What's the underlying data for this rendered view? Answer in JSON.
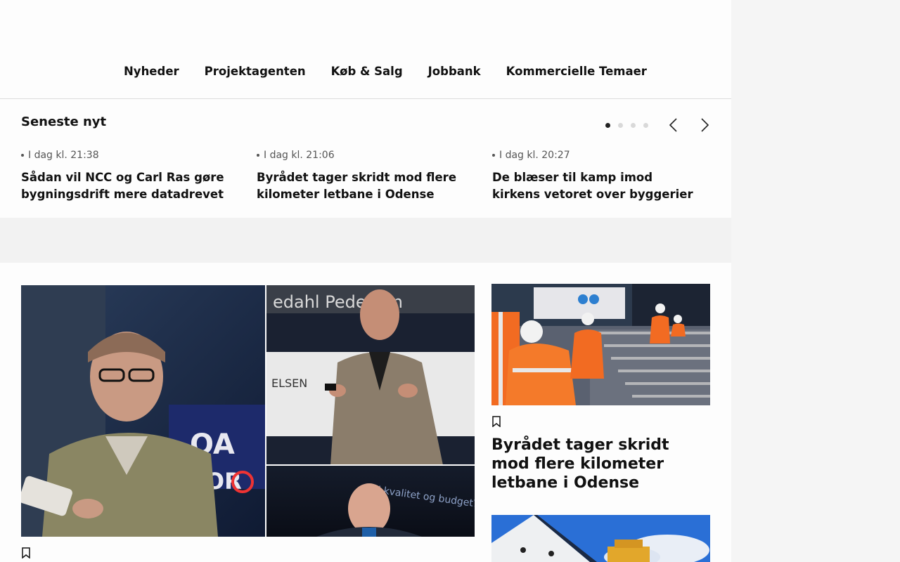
{
  "nav": {
    "items": [
      "Nyheder",
      "Projektagenten",
      "Køb & Salg",
      "Jobbank",
      "Kommercielle Temaer"
    ]
  },
  "latest": {
    "title": "Seneste nyt",
    "items": [
      {
        "time": "I dag kl. 21:38",
        "title": "Sådan vil NCC og Carl Ras gøre bygningsdrift mere datadrevet"
      },
      {
        "time": "I dag kl. 21:06",
        "title": "Byrådet tager skridt mod flere kilometer letbane i Odense"
      },
      {
        "time": "I dag kl. 20:27",
        "title": "De blæser til kamp imod kirkens vetoret over byggerier"
      }
    ],
    "carousel_pages": 4,
    "carousel_active": 1
  },
  "main": {
    "side_article_title": "Byrådet tager skridt mod flere kilometer letbane i Odense"
  },
  "icons": {
    "prev": "chevron-left-icon",
    "next": "chevron-right-icon",
    "bookmark": "bookmark-icon"
  },
  "colors": {
    "text": "#111111",
    "muted": "#555555",
    "dot_inactive": "#d9d9d9",
    "dot_active": "#222222",
    "page_bg": "#f5f5f5"
  }
}
